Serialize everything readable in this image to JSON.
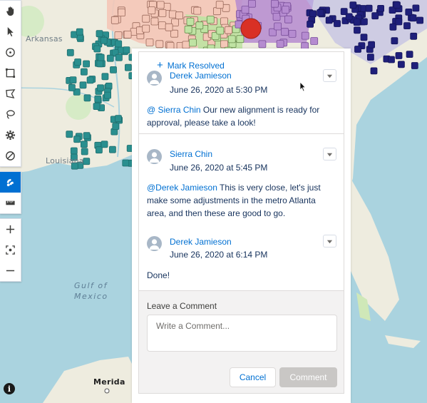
{
  "map": {
    "labels": {
      "arkansas": "Arkansas",
      "louisiana": "Louisiana",
      "gulf_line1": "Gulf of",
      "gulf_line2": "Mexico",
      "merida": "Merida"
    },
    "colors": {
      "water": "#aad3df",
      "land": "#eeecdf",
      "teal_region": "#2a8f8f",
      "pink_region": "#f4c7b7",
      "green_region": "#bfe3a3",
      "purple_region": "#b58bd0",
      "navy_region": "#1f1f7a",
      "selected_marker": "#d93025"
    }
  },
  "toolbar": {
    "group1": [
      {
        "icon": "hand-pan-icon"
      },
      {
        "icon": "pointer-select-icon"
      },
      {
        "icon": "radius-select-icon"
      },
      {
        "icon": "rectangle-select-icon"
      },
      {
        "icon": "polygon-select-icon"
      },
      {
        "icon": "lasso-select-icon"
      },
      {
        "icon": "settings-gear-icon"
      },
      {
        "icon": "clear-selection-icon"
      }
    ],
    "group2": [
      {
        "icon": "layers-icon",
        "active": true
      },
      {
        "icon": "ruler-icon"
      }
    ],
    "group3": [
      {
        "icon": "zoom-in-icon"
      },
      {
        "icon": "fit-extent-icon"
      },
      {
        "icon": "zoom-out-icon"
      }
    ],
    "info_glyph": "i",
    "accent_color": "#0070d2"
  },
  "panel": {
    "mark_resolved": "Mark Resolved",
    "comments": [
      {
        "author": "Derek Jamieson",
        "date": "June 26, 2020 at 5:30 PM",
        "mention": "@ Sierra Chin",
        "text": " Our new alignment is ready for approval, please take a look!"
      },
      {
        "author": "Sierra Chin",
        "date": "June 26, 2020 at 5:45 PM",
        "mention": "@Derek Jamieson",
        "text": " This is very close, let's just make some adjustments in the metro Atlanta area, and then these are good to go."
      },
      {
        "author": "Derek Jamieson",
        "date": "June 26, 2020 at 6:14 PM",
        "mention": "",
        "text": "Done!"
      }
    ],
    "reply": {
      "label": "Leave a Comment",
      "placeholder": "Write a Comment...",
      "cancel_label": "Cancel",
      "submit_label": "Comment"
    }
  }
}
